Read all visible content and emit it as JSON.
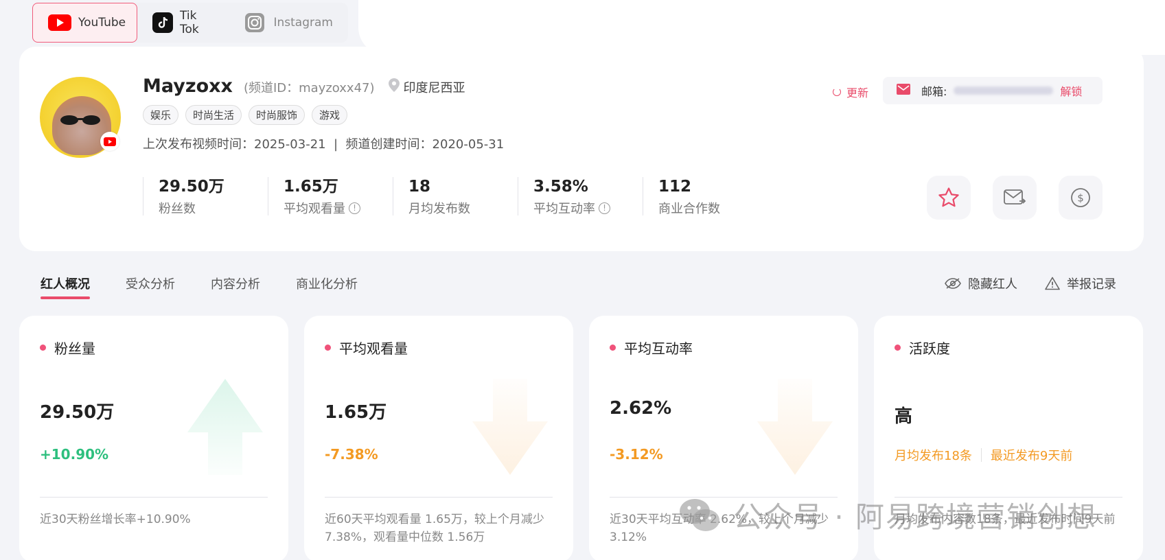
{
  "platform_tabs": [
    {
      "label": "YouTube",
      "icon": "youtube-icon",
      "active": true
    },
    {
      "label": "Tik Tok",
      "icon": "tiktok-icon",
      "active": false
    },
    {
      "label": "Instagram",
      "icon": "instagram-icon",
      "active": false
    }
  ],
  "profile": {
    "name": "Mayzoxx",
    "channel_id": "(频道ID：mayzoxx47)",
    "location": "印度尼西亚",
    "tags": [
      "娱乐",
      "时尚生活",
      "时尚服饰",
      "游戏"
    ],
    "dates": "上次发布视频时间：2025-03-21  |  频道创建时间：2020-05-31",
    "refresh_label": "更新",
    "email_label": "邮箱:",
    "unlock_label": "解锁"
  },
  "stats": [
    {
      "value": "29.50万",
      "label": "粉丝数",
      "info": false
    },
    {
      "value": "1.65万",
      "label": "平均观看量",
      "info": true
    },
    {
      "value": "18",
      "label": "月均发布数",
      "info": false
    },
    {
      "value": "3.58%",
      "label": "平均互动率",
      "info": true
    },
    {
      "value": "112",
      "label": "商业合作数",
      "info": false
    }
  ],
  "section_tabs": [
    "红人概况",
    "受众分析",
    "内容分析",
    "商业化分析"
  ],
  "right_actions": {
    "hide": "隐藏红人",
    "report": "举报记录"
  },
  "metrics": {
    "fans": {
      "title": "粉丝量",
      "value": "29.50万",
      "change": "+10.90%",
      "desc": "近30天粉丝增长率+10.90%"
    },
    "views": {
      "title": "平均观看量",
      "value": "1.65万",
      "change": "-7.38%",
      "desc": "近60天平均观看量 1.65万，较上个月减少 7.38%，观看量中位数 1.56万"
    },
    "engagement": {
      "title": "平均互动率",
      "value": "2.62%",
      "change": "-3.12%",
      "desc": "近30天平均互动率 2.62%，较上个月减少 3.12%"
    },
    "activity": {
      "title": "活跃度",
      "value": "高",
      "monthly": "月均发布18条",
      "recent": "最近发布9天前",
      "desc": "月均发布内容数18条，最近发布时间9天前"
    }
  },
  "watermark": "公众号 · 阿易跨境营销创想",
  "colors": {
    "accent": "#e94b6a",
    "up": "#2dbf7e",
    "down": "#f39a23"
  }
}
